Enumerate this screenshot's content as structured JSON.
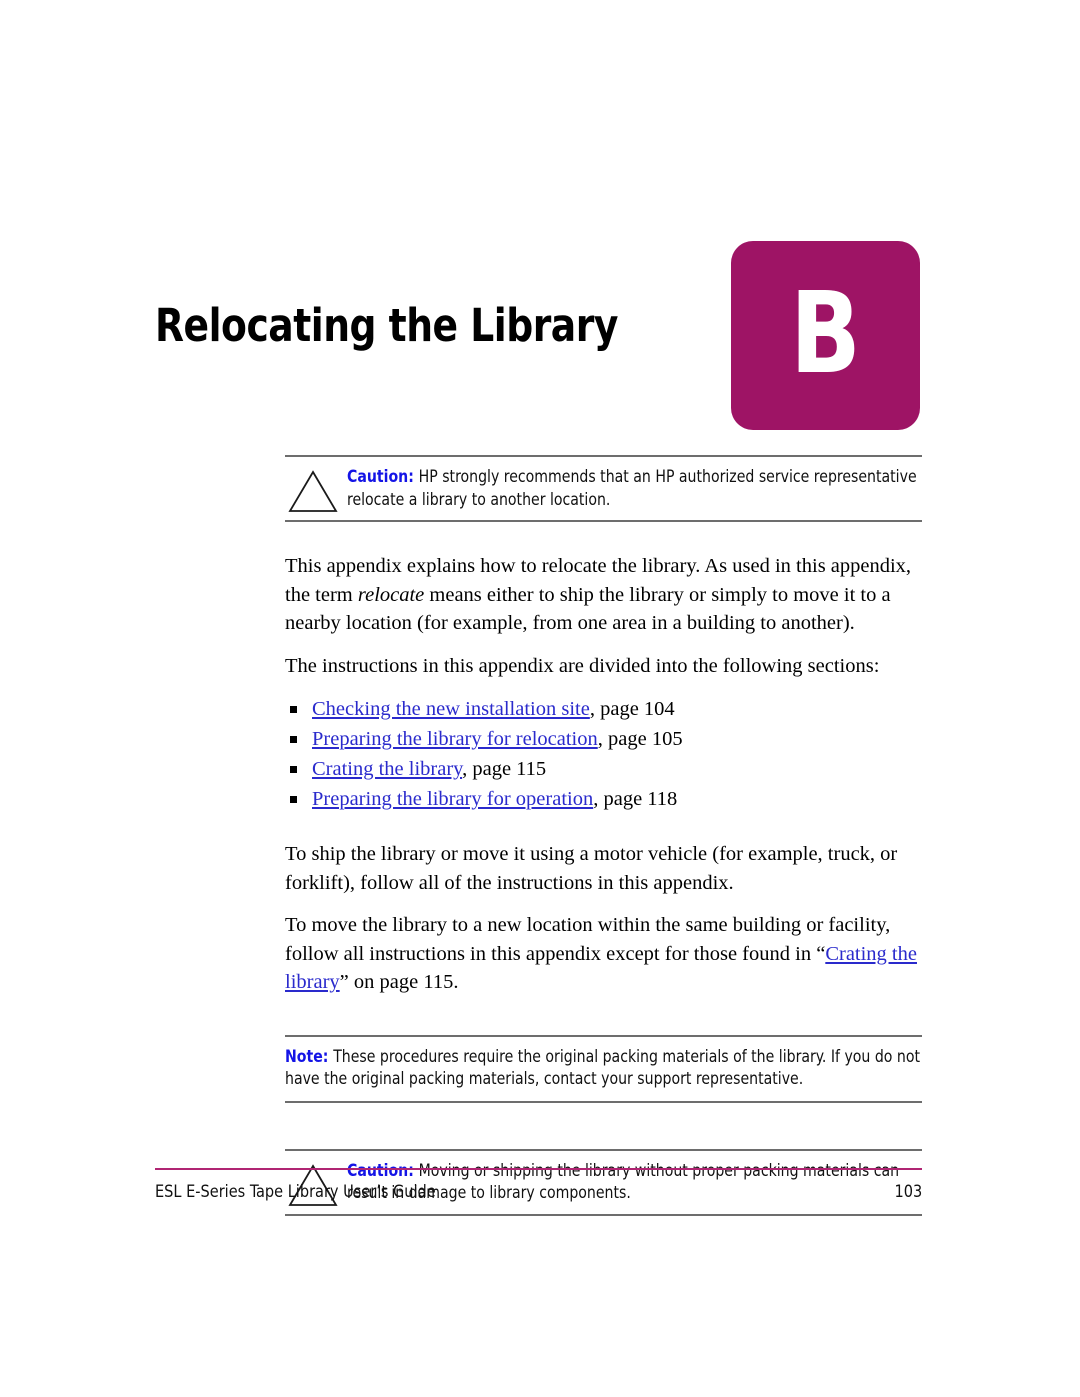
{
  "page": {
    "chapter_title": "Relocating the Library",
    "chapter_letter": "B",
    "badge_color": "#9E1465",
    "link_color": "#2A2ACC",
    "admonition_label_color": "#1414E6",
    "footer_rule_color": "#B02573"
  },
  "caution_top": {
    "label": "Caution:",
    "text": "HP strongly recommends that an HP authorized service representative relocate a library to another location.",
    "icon": "warning-triangle-icon"
  },
  "intro": {
    "paragraph_1_part_1": "This appendix explains how to relocate the library. As used in this appendix, the term ",
    "paragraph_1_emphasis": "relocate",
    "paragraph_1_part_2": " means either to ship the library or simply to move it to a nearby location (for example, from one area in a building to another).",
    "paragraph_2": "The instructions in this appendix are divided into the following sections:"
  },
  "section_list": [
    {
      "link": "Checking the new installation site",
      "page_ref": ", page 104"
    },
    {
      "link": "Preparing the library for relocation",
      "page_ref": ", page 105"
    },
    {
      "link": "Crating the library",
      "page_ref": ", page 115"
    },
    {
      "link": "Preparing the library for operation",
      "page_ref": ", page 118"
    }
  ],
  "after_list": {
    "paragraph_3": "To ship the library or move it using a motor vehicle (for example, truck, or forklift), follow all of the instructions in this appendix.",
    "paragraph_4_part_1": "To move the library to a new location within the same building or facility, follow all instructions in this appendix except for those found in “",
    "paragraph_4_link": "Crating the library",
    "paragraph_4_part_2": "” on page 115."
  },
  "note_box": {
    "label": "Note:",
    "text": "These procedures require the original packing materials of the library. If you do not have the original packing materials, contact your support representative."
  },
  "caution_bottom": {
    "label": "Caution:",
    "text": "Moving or shipping the library without proper packing materials can result in damage to library components.",
    "icon": "warning-triangle-icon"
  },
  "footer": {
    "document_title": "ESL E-Series Tape Library User’s Guide",
    "page_number": "103"
  }
}
